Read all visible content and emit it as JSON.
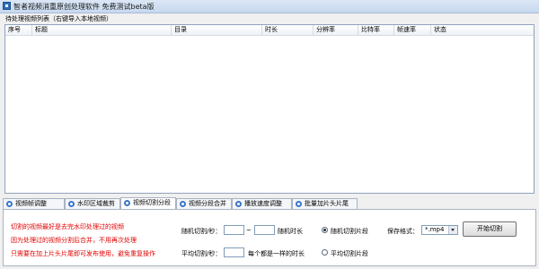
{
  "window": {
    "title": "智者视频消重原创处理软件 免费测试beta版"
  },
  "list": {
    "caption": "待处理视频列表（右键导入本地视频）",
    "columns": [
      "序号",
      "标题",
      "目录",
      "时长",
      "分辨率",
      "比特率",
      "帧速率",
      "状态"
    ],
    "rows": []
  },
  "tabs": [
    {
      "label": "视频帧调整",
      "active": false
    },
    {
      "label": "水印区域裁剪",
      "active": false
    },
    {
      "label": "视频切割分段",
      "active": true
    },
    {
      "label": "视频分段合并",
      "active": false
    },
    {
      "label": "播放速度调整",
      "active": false
    },
    {
      "label": "批量加片头片尾",
      "active": false
    }
  ],
  "panel": {
    "notes": [
      "切割的视频最好是去完水印处理过的视频",
      "因为处理过的视频分割后合并，不用再次处理",
      "只需要在加上片头片尾即可发布使用，避免重复操作"
    ],
    "random_label": "随机切割/秒：",
    "random_min": "",
    "tilde": "~",
    "random_max": "",
    "random_suffix": "随机时长",
    "avg_label": "平均切割/秒：",
    "avg_value": "",
    "avg_suffix": "每个都是一样的时长",
    "radio_random": {
      "label": "随机切割片段",
      "checked": true
    },
    "radio_avg": {
      "label": "平均切割片段",
      "checked": false
    },
    "format_label": "保存格式：",
    "format_value": "*.mp4",
    "start_button": "开始切割"
  }
}
